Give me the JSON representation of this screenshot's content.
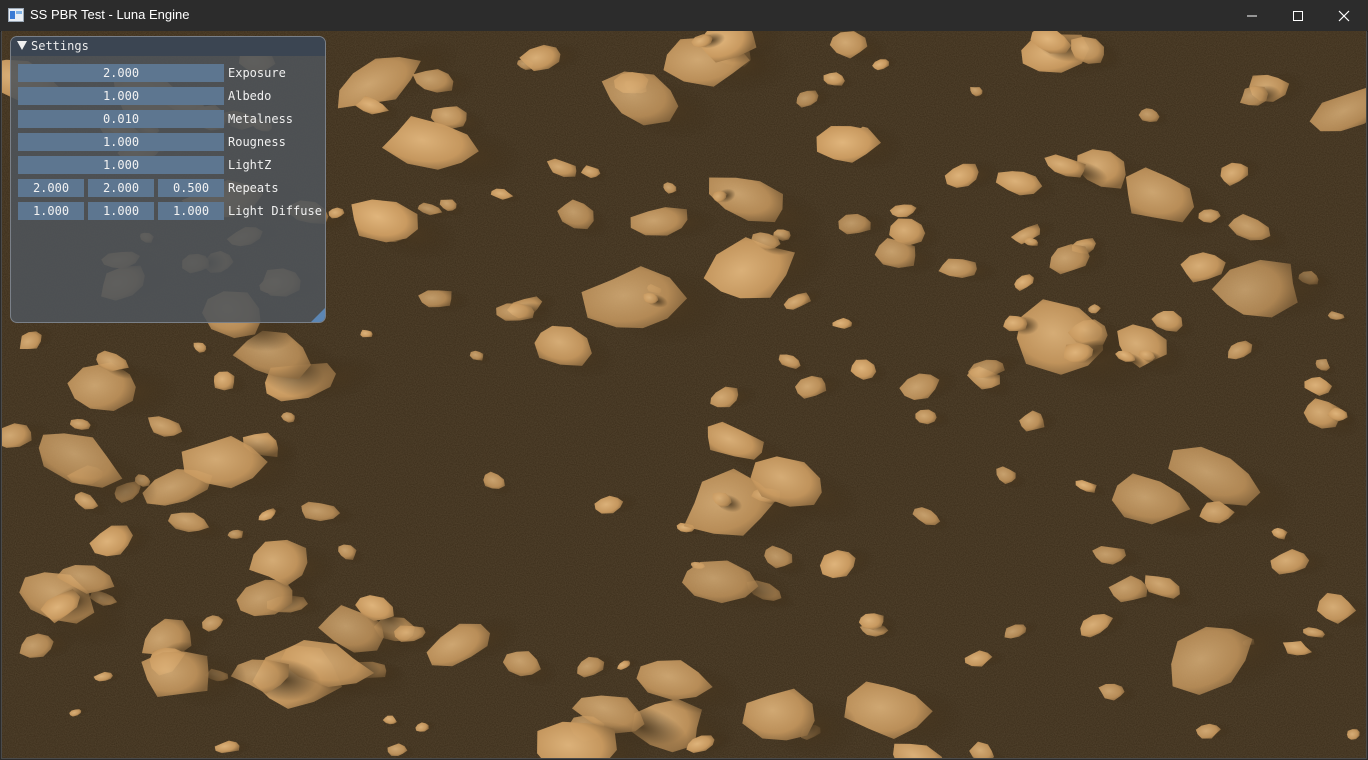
{
  "window": {
    "title": "SS PBR Test - Luna Engine",
    "icons": {
      "app": "app-window-icon",
      "minimize": "minimize-icon",
      "maximize": "maximize-icon",
      "close": "close-icon"
    }
  },
  "settings_panel": {
    "title": "Settings",
    "collapse_icon": "triangle-down-icon",
    "rows": [
      {
        "label": "Exposure",
        "values": [
          "2.000"
        ]
      },
      {
        "label": "Albedo",
        "values": [
          "1.000"
        ]
      },
      {
        "label": "Metalness",
        "values": [
          "0.010"
        ]
      },
      {
        "label": "Rougness",
        "values": [
          "1.000"
        ]
      },
      {
        "label": "LightZ",
        "values": [
          "1.000"
        ]
      },
      {
        "label": "Repeats",
        "values": [
          "2.000",
          "2.000",
          "0.500"
        ]
      },
      {
        "label": "Light Diffuse",
        "values": [
          "1.000",
          "1.000",
          "1.000"
        ]
      }
    ]
  },
  "colors": {
    "ground_dark": "#3a2c19",
    "ground_mid": "#5a4428",
    "stone_light": "#d9b07a",
    "stone_shadow": "#8a6a42",
    "slider_fill": "#5d7690",
    "panel_header": "#3b4552"
  }
}
